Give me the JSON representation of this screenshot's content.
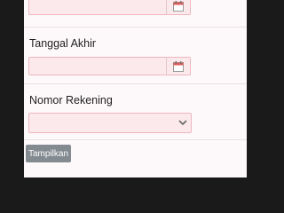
{
  "form": {
    "start_date": {
      "value": "",
      "icon": "calendar-icon"
    },
    "end_date": {
      "label": "Tanggal Akhir",
      "value": "",
      "icon": "calendar-icon"
    },
    "account_number": {
      "label": "Nomor Rekening",
      "selected": "",
      "icon": "chevron-down-icon"
    },
    "submit_label": "Tampilkan"
  },
  "colors": {
    "field_bg": "#fbe9ec",
    "field_border": "#efb7c1",
    "button_bg": "#838b91"
  }
}
